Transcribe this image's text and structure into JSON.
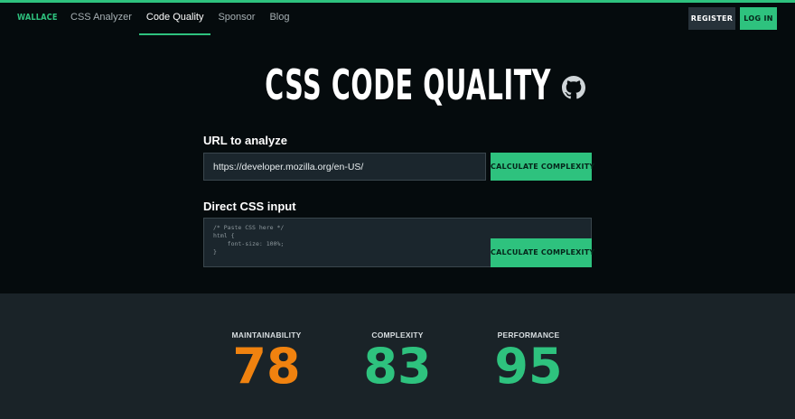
{
  "header": {
    "brand": "WALLACE",
    "nav": [
      {
        "label": "CSS Analyzer",
        "active": false
      },
      {
        "label": "Code Quality",
        "active": true
      },
      {
        "label": "Sponsor",
        "active": false
      },
      {
        "label": "Blog",
        "active": false
      }
    ],
    "register_label": "REGISTER",
    "login_label": "LOG IN"
  },
  "hero": {
    "title": "CSS CODE QUALITY",
    "github_icon": "github-icon"
  },
  "url_form": {
    "label": "URL to analyze",
    "value": "https://developer.mozilla.org/en-US/",
    "button_label": "CALCULATE COMPLEXITY"
  },
  "css_form": {
    "label": "Direct CSS input",
    "code": "/* Paste CSS here */\nhtml {\n    font-size: 100%;\n}",
    "button_label": "CALCULATE COMPLEXITY"
  },
  "results": [
    {
      "label": "MAINTAINABILITY",
      "value": "78",
      "color": "#f0820f"
    },
    {
      "label": "COMPLEXITY",
      "value": "83",
      "color": "#2ec27e"
    },
    {
      "label": "PERFORMANCE",
      "value": "95",
      "color": "#2ec27e"
    }
  ],
  "colors": {
    "accent": "#2ec27e",
    "warning": "#f0820f",
    "background": "#050b0d",
    "results_background": "#1a2328"
  }
}
